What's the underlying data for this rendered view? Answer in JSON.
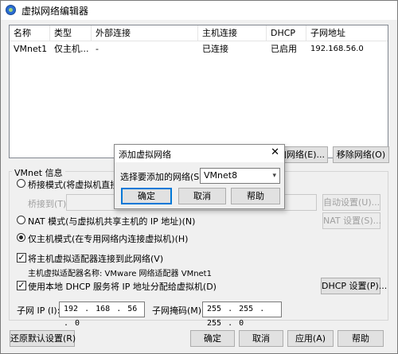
{
  "window": {
    "title": "虚拟网络编辑器"
  },
  "table": {
    "headers": [
      "名称",
      "类型",
      "外部连接",
      "主机连接",
      "DHCP",
      "子网地址"
    ],
    "rows": [
      [
        "VMnet1",
        "仅主机...",
        "-",
        "已连接",
        "已启用",
        "192.168.56.0"
      ]
    ]
  },
  "list_buttons": {
    "add_network": "添加网络(E)...",
    "remove_network": "移除网络(O)"
  },
  "vmnet_info": {
    "group_label": "VMnet 信息",
    "bridge_mode": "桥接模式(将虚拟机直接连",
    "bridge_to": "桥接到(T):",
    "auto_settings": "自动设置(U)...",
    "nat_mode": "NAT 模式(与虚拟机共享主机的 IP 地址)(N)",
    "nat_settings": "NAT 设置(S)...",
    "host_only_mode": "仅主机模式(在专用网络内连接虚拟机)(H)",
    "connect_adapter": "将主机虚拟适配器连接到此网络(V)",
    "adapter_name": "主机虚拟适配器名称: VMware 网络适配器 VMnet1",
    "use_dhcp": "使用本地 DHCP 服务将 IP 地址分配给虚拟机(D)",
    "dhcp_settings": "DHCP 设置(P)...",
    "subnet_ip_label": "子网 IP (I):",
    "subnet_ip": "192 . 168 . 56 . 0",
    "subnet_mask_label": "子网掩码(M):",
    "subnet_mask": "255 . 255 . 255 . 0",
    "selected_mode": "host-only",
    "connect_adapter_checked": true,
    "use_dhcp_checked": true
  },
  "footer": {
    "restore_defaults": "还原默认设置(R)",
    "ok": "确定",
    "cancel": "取消",
    "apply": "应用(A)",
    "help": "帮助"
  },
  "dialog": {
    "title": "添加虚拟网络",
    "close_glyph": "✕",
    "select_label": "选择要添加的网络(S):",
    "select_value": "VMnet8",
    "ok": "确定",
    "cancel": "取消",
    "help": "帮助"
  },
  "icons": {
    "check": "✓",
    "dropdown": "▾"
  }
}
